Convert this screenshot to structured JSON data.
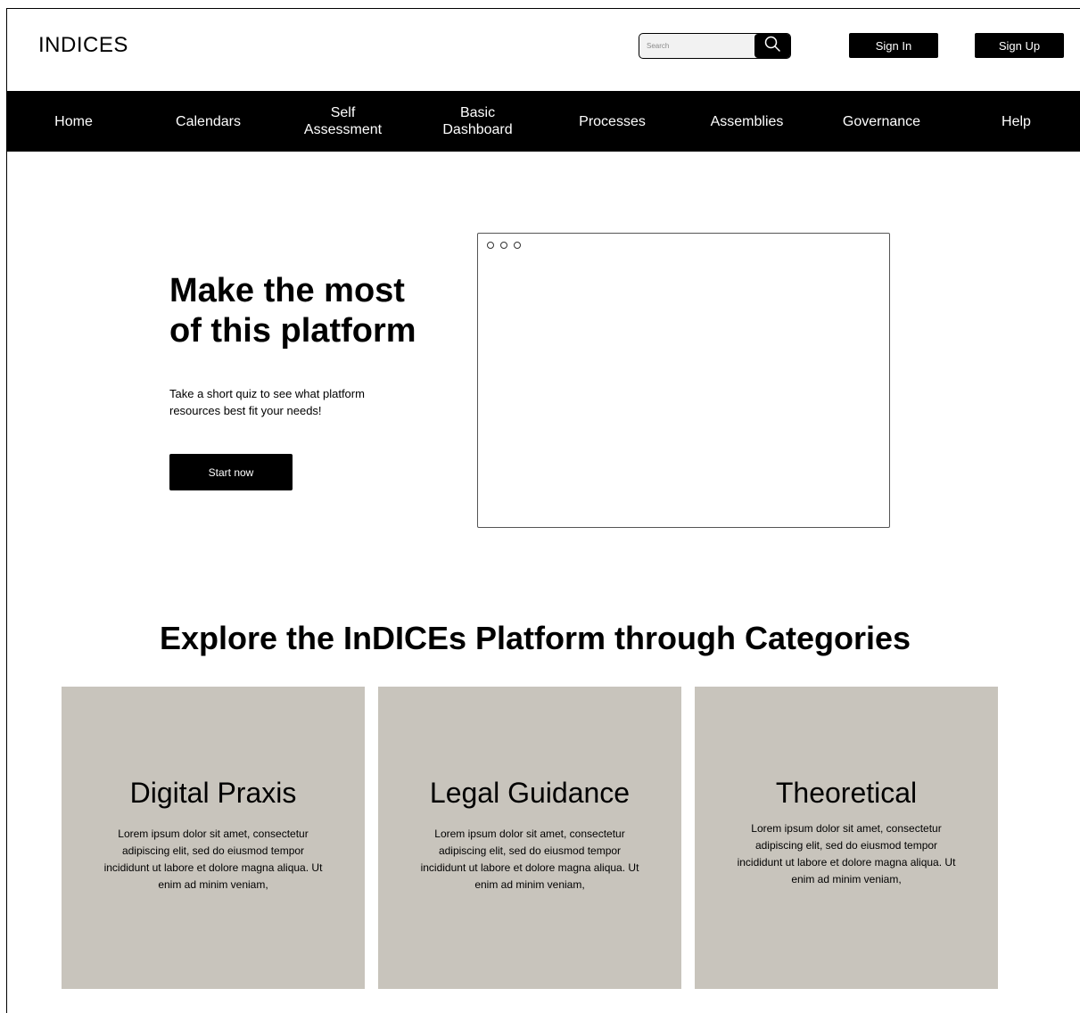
{
  "header": {
    "logo": "INDICES",
    "search_placeholder": "Search",
    "sign_in": "Sign In",
    "sign_up": "Sign Up"
  },
  "nav": {
    "items": [
      {
        "line1": "Home",
        "line2": ""
      },
      {
        "line1": "Calendars",
        "line2": ""
      },
      {
        "line1": "Self",
        "line2": "Assessment"
      },
      {
        "line1": "Basic",
        "line2": "Dashboard"
      },
      {
        "line1": "Processes",
        "line2": ""
      },
      {
        "line1": "Assemblies",
        "line2": ""
      },
      {
        "line1": "Governance",
        "line2": ""
      },
      {
        "line1": "Help",
        "line2": ""
      }
    ]
  },
  "hero": {
    "title_line1": "Make the most",
    "title_line2": "of this platform",
    "text_line1": "Take a short quiz to see what platform",
    "text_line2": "resources best fit your needs!",
    "button": "Start now"
  },
  "categories": {
    "title": "Explore the InDICEs Platform through Categories",
    "cards": [
      {
        "title": "Digital Praxis",
        "lines": [
          "Lorem ipsum dolor sit amet, consectetur",
          "adipiscing elit, sed do eiusmod tempor",
          "incididunt ut labore et dolore magna aliqua. Ut",
          "enim ad minim veniam,"
        ]
      },
      {
        "title": "Legal Guidance",
        "lines": [
          "Lorem ipsum dolor sit amet, consectetur",
          "adipiscing elit, sed do eiusmod tempor",
          "incididunt ut labore et dolore magna aliqua. Ut",
          "enim ad minim veniam,"
        ]
      },
      {
        "title": "Theoretical",
        "lines": [
          "Lorem ipsum dolor sit amet, consectetur",
          "adipiscing elit, sed do eiusmod tempor",
          "incididunt ut labore et dolore magna aliqua. Ut",
          "enim ad minim veniam,"
        ]
      }
    ]
  },
  "colors": {
    "nav_bg": "#000000",
    "card_bg": "#c8c4bc",
    "button_bg": "#000000"
  },
  "icons": {
    "search": "search-icon"
  }
}
